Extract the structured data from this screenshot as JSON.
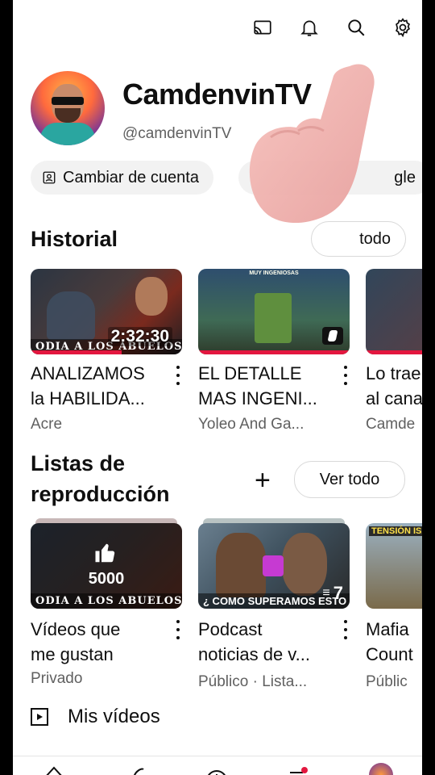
{
  "topbar": {
    "icons": [
      "cast-icon",
      "notifications-icon",
      "search-icon",
      "settings-icon"
    ]
  },
  "channel": {
    "name": "CamdenvinTV",
    "handle": "@camdenvinTV"
  },
  "chips": {
    "switch_account": "Cambiar de cuenta",
    "google_account_partial": "gle"
  },
  "history": {
    "title": "Historial",
    "see_all": "todo",
    "items": [
      {
        "title": "ANALIZAMOS\nla HABILIDA...",
        "channel": "Acre",
        "duration": "2:32:30",
        "caption": "ODIA A LOS ABUELOS",
        "progress": 0.6
      },
      {
        "title": "EL DETALLE\nMAS INGENI...",
        "channel": "Yoleo And Ga...",
        "thumb_text": "MUY INGENIOSAS",
        "progress": 1.0
      },
      {
        "title": "Lo trae\nal cana",
        "channel": "Camde",
        "progress": 1.0
      }
    ]
  },
  "playlists": {
    "title": "Listas de\nreproducción",
    "see_all": "Ver todo",
    "items": [
      {
        "title": "Vídeos que\nme gustan",
        "visibility": "Privado",
        "count": "5000",
        "caption": "ODIA A LOS ABUELOS"
      },
      {
        "title": "Podcast\nnoticias de v...",
        "visibility": "Público · Lista...",
        "count": "7",
        "caption": "¿ COMO SUPERAMOS ESTO ?"
      },
      {
        "title": "Mafia\nCount",
        "visibility": "Públic",
        "caption": "TENSIÓN ISA"
      }
    ]
  },
  "my_videos": {
    "label": "Mis vídeos"
  },
  "colors": {
    "progress_red": "#e3173f",
    "chip_bg": "#f2f2f2",
    "muted_text": "#606060"
  }
}
